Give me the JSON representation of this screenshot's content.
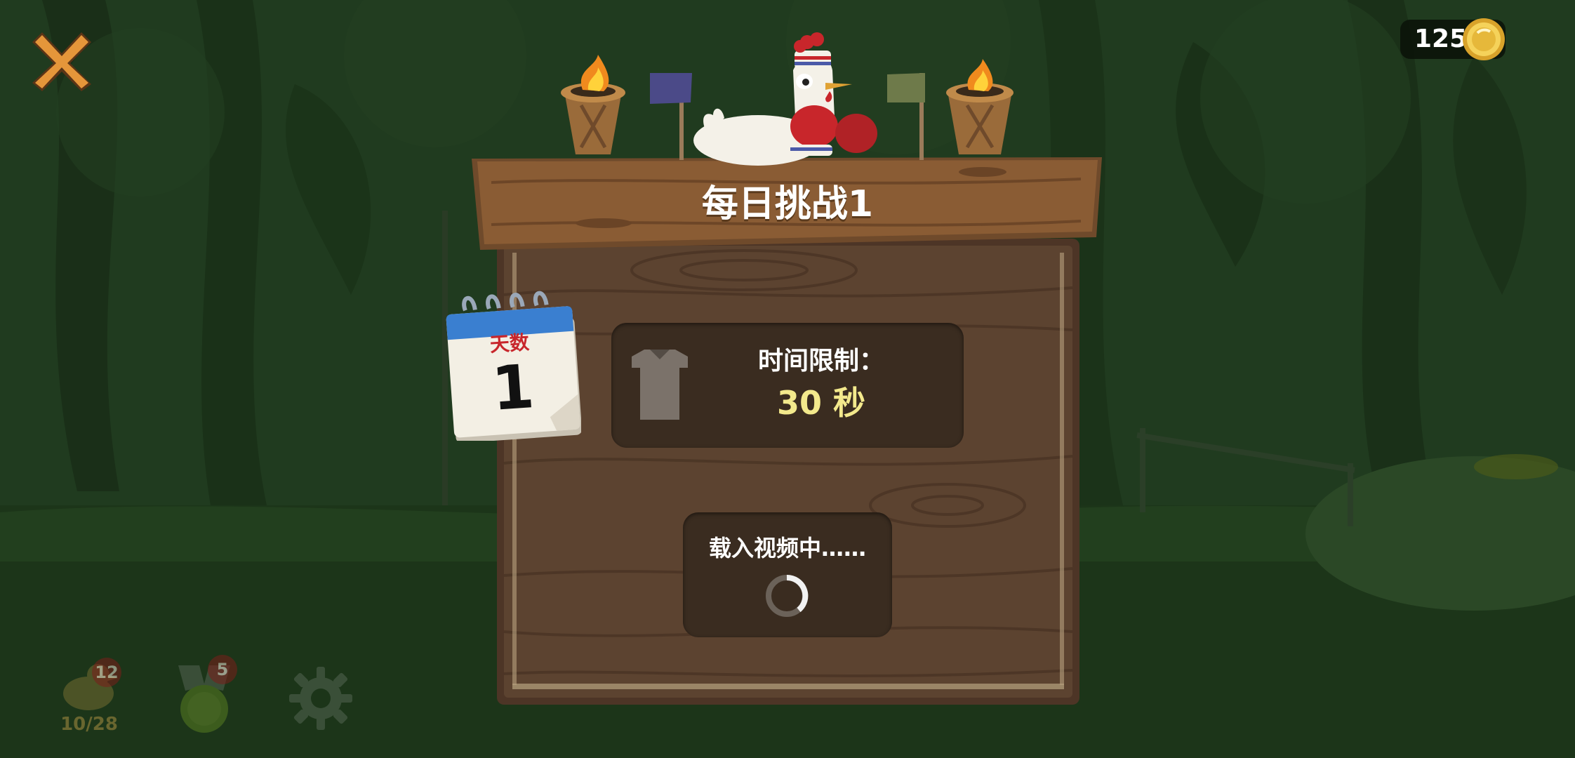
{
  "coins": {
    "value": "125",
    "icon": "gold-coin-icon"
  },
  "challenge": {
    "title": "每日挑战1",
    "calendar_label": "天数",
    "calendar_day": "1",
    "time_limit_label": "时间限制：",
    "time_limit_value": "30",
    "time_limit_unit": "秒",
    "loading_text": "载入视频中……"
  },
  "bottom_bar": {
    "chicken_badge": "12",
    "chicken_progress": "10/28",
    "achievement_badge": "5"
  },
  "colors": {
    "title_text": "#ffffff",
    "time_value": "#f3e98c",
    "calendar_label": "#c8262b",
    "wood": "#5c4330",
    "panel": "#3a2c20",
    "forest_bg": "#1c3219"
  }
}
